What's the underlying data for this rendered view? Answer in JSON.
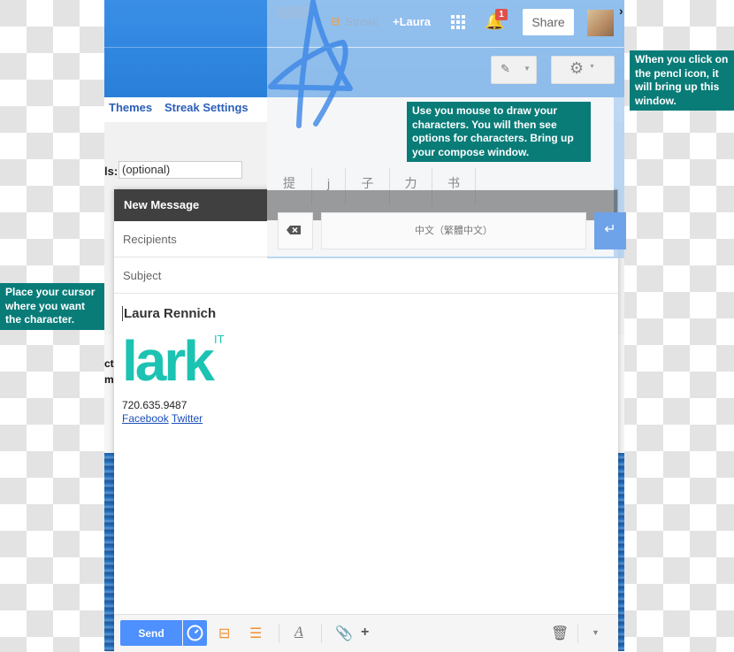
{
  "gmail": {
    "nav_links": [
      "Themes",
      "Streak Settings"
    ],
    "bcc_label": "ls:",
    "bcc_placeholder": "(optional)",
    "cut_text": [
      "cts",
      "ma"
    ]
  },
  "handwriting_panel": {
    "streak_label": "Streak",
    "user_label": "+Laura",
    "notification_count": "1",
    "share_label": "Share",
    "candidates": [
      "提",
      "j",
      "子",
      "力",
      "书"
    ],
    "language_label": "中文（繁體中文）",
    "icons": {
      "streak": "streak-icon",
      "apps": "apps-grid-icon",
      "bell": "bell-icon",
      "pencil": "pencil-icon",
      "gear": "gear-icon",
      "backspace": "backspace-icon",
      "enter": "enter-icon"
    }
  },
  "compose": {
    "title": "New Message",
    "recipients_placeholder": "Recipients",
    "subject_placeholder": "Subject",
    "signature": {
      "name": "Laura Rennich",
      "logo_text": "lark",
      "logo_sup": "IT",
      "phone": "720.635.9487",
      "links": [
        "Facebook",
        "Twitter"
      ]
    },
    "send_label": "Send",
    "header_icons": [
      "minimize-icon",
      "expand-icon",
      "close-icon"
    ]
  },
  "callouts": {
    "draw": "Use you mouse to draw your characters.  You will then see options for characters.  Bring up your compose window.",
    "pencil": "When you click on the pencl icon, it will bring up this window.",
    "cursor": "Place your cursor where you want the character."
  },
  "colors": {
    "callout": "#097c78",
    "send": "#4d90fe",
    "lark": "#1cc3b2",
    "stroke": "#3b86e6"
  }
}
